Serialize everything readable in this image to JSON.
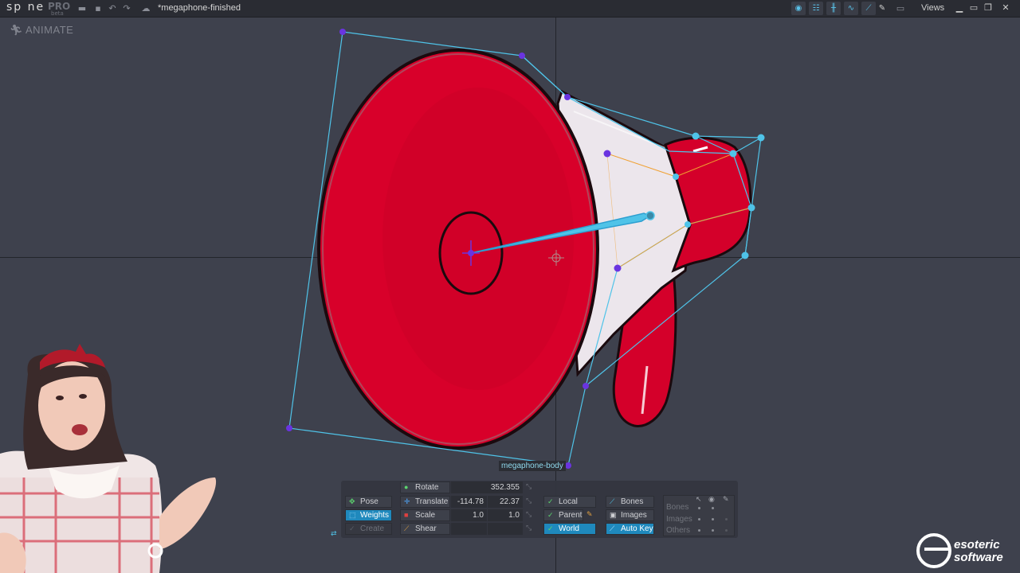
{
  "app": {
    "logo": "sp ne",
    "edition": "PRO",
    "edition_sub": "beta",
    "filename": "*megaphone-finished",
    "views_label": "Views"
  },
  "viewport": {
    "mode_label": "ANIMATE",
    "attachment_label": "megaphone-body"
  },
  "tools": {
    "pose": "Pose",
    "weights": "Weights",
    "create": "Create"
  },
  "transform": {
    "rotate_label": "Rotate",
    "rotate_value": "352.355",
    "translate_label": "Translate",
    "translate_x": "-114.78",
    "translate_y": "22.37",
    "scale_label": "Scale",
    "scale_x": "1.0",
    "scale_y": "1.0",
    "shear_label": "Shear"
  },
  "axes": {
    "local": "Local",
    "parent": "Parent",
    "world": "World"
  },
  "options": {
    "bones": "Bones",
    "images": "Images",
    "autokey": "Auto Key"
  },
  "visibility": {
    "rows": [
      "Bones",
      "Images",
      "Others"
    ]
  },
  "brand": {
    "line1": "esoteric",
    "line2": "software"
  },
  "colors": {
    "accent": "#1f89bd",
    "mesh": "#4fc3e8",
    "bone": "#6a34e0",
    "megaphone": "#d8002a"
  }
}
